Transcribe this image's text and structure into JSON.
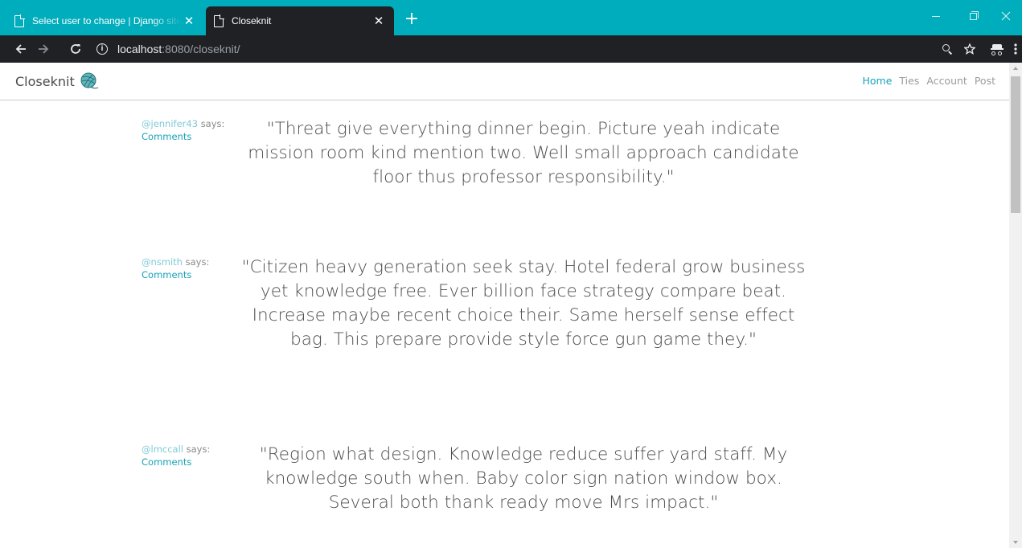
{
  "browser": {
    "tabs": [
      {
        "title": "Select user to change | Django site admin",
        "close": "✕",
        "active": false
      },
      {
        "title": "Closeknit",
        "close": "✕",
        "active": true
      }
    ],
    "new_tab_label": "+",
    "address": {
      "host": "localhost",
      "rest": ":8080/closeknit/",
      "info_icon": "info-icon"
    },
    "icons": {
      "back": "arrow-left-icon",
      "forward": "arrow-right-icon",
      "reload": "reload-icon",
      "zoom": "zoom-icon",
      "bookmark": "star-icon",
      "incognito": "incognito-icon",
      "menu": "kebab-menu-icon"
    },
    "colors": {
      "tabstrip": "#00adbc",
      "toolbar": "#202124"
    }
  },
  "site": {
    "brand": "Closeknit",
    "brand_logo": "yarn-ball-icon",
    "nav": [
      {
        "label": "Home",
        "active": true
      },
      {
        "label": "Ties",
        "active": false
      },
      {
        "label": "Account",
        "active": false
      },
      {
        "label": "Post",
        "active": false
      }
    ],
    "colors": {
      "accent": "#17a2b8",
      "username": "#7fcad5",
      "text": "#4d4d4d"
    }
  },
  "posts": [
    {
      "user": "@jennifer43",
      "says": "says:",
      "comments": "Comments",
      "text": "\"Threat give everything dinner begin. Picture yeah indicate mission room kind mention two. Well small approach candidate floor thus professor responsibility.\""
    },
    {
      "user": "@nsmith",
      "says": "says:",
      "comments": "Comments",
      "text": "\"Citizen heavy generation seek stay. Hotel federal grow business yet knowledge free. Ever billion face strategy compare beat. Increase maybe recent choice their. Same herself sense effect bag. This prepare provide style force gun game they.\""
    },
    {
      "user": "@lmccall",
      "says": "says:",
      "comments": "Comments",
      "text": "\"Region what design. Knowledge reduce suffer yard staff. My knowledge south when. Baby color sign nation window box. Several both thank ready move Mrs impact.\""
    }
  ]
}
